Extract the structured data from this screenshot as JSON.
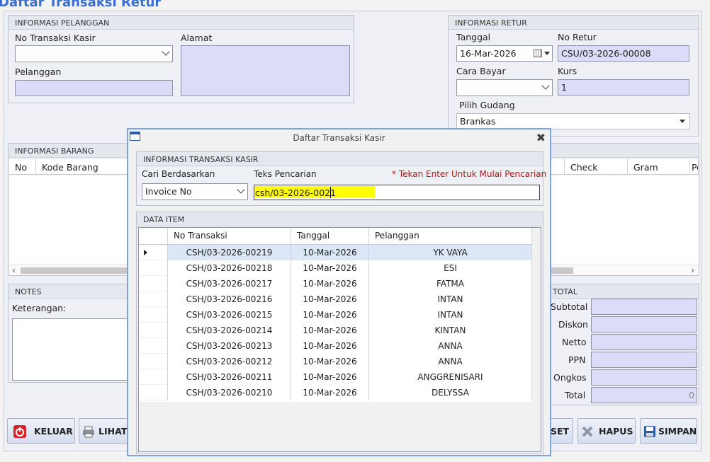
{
  "window_title_fragment": "Daftar Transaksi Retur",
  "customer": {
    "group_title": "INFORMASI PELANGGAN",
    "no_transaksi_label": "No Transaksi Kasir",
    "no_transaksi_value": "",
    "alamat_label": "Alamat",
    "alamat_value": "",
    "pelanggan_label": "Pelanggan",
    "pelanggan_value": ""
  },
  "retur": {
    "group_title": "INFORMASI RETUR",
    "tanggal_label": "Tanggal",
    "tanggal_value": "16-Mar-2026",
    "no_retur_label": "No Retur",
    "no_retur_value": "CSU/03-2026-00008",
    "cara_bayar_label": "Cara Bayar",
    "cara_bayar_value": "",
    "kurs_label": "Kurs",
    "kurs_value": "1",
    "gudang_label": "Pilih Gudang",
    "gudang_value": "Brankas"
  },
  "barang": {
    "group_title": "INFORMASI BARANG",
    "columns": [
      "No",
      "Kode Barang",
      "Check",
      "Gram",
      "Pe"
    ]
  },
  "notes": {
    "group_title": "NOTES",
    "keterangan_label": "Keterangan:",
    "keterangan_value": ""
  },
  "total": {
    "group_title": "TOTAL",
    "subtotal_label": "Subtotal",
    "diskon_label": "Diskon",
    "netto_label": "Netto",
    "ppn_label": "PPN",
    "ongkos_label": "Ongkos",
    "total_label": "Total",
    "total_value": "0"
  },
  "buttons": {
    "keluar": "KELUAR",
    "lihat": "LIHAT",
    "reset": "SET",
    "hapus": "HAPUS",
    "simpan": "SIMPAN"
  },
  "dialog": {
    "title": "Daftar Transaksi Kasir",
    "info_group_title": "INFORMASI TRANSAKSI KASIR",
    "cari_label": "Cari Berdasarkan",
    "cari_value": "Invoice No",
    "teks_label": "Teks Pencarian",
    "teks_value": "csh/03-2026-0021",
    "hint": "* Tekan Enter Untuk Mulai Pencarian",
    "data_group_title": "DATA ITEM",
    "columns": [
      "No Transaksi",
      "Tanggal",
      "Pelanggan"
    ],
    "rows": [
      {
        "no": "CSH/03-2026-00219",
        "tanggal": "10-Mar-2026",
        "pelanggan": "YK VAYA"
      },
      {
        "no": "CSH/03-2026-00218",
        "tanggal": "10-Mar-2026",
        "pelanggan": "ESI"
      },
      {
        "no": "CSH/03-2026-00217",
        "tanggal": "10-Mar-2026",
        "pelanggan": "FATMA"
      },
      {
        "no": "CSH/03-2026-00216",
        "tanggal": "10-Mar-2026",
        "pelanggan": "INTAN"
      },
      {
        "no": "CSH/03-2026-00215",
        "tanggal": "10-Mar-2026",
        "pelanggan": "INTAN"
      },
      {
        "no": "CSH/03-2026-00214",
        "tanggal": "10-Mar-2026",
        "pelanggan": "KINTAN"
      },
      {
        "no": "CSH/03-2026-00213",
        "tanggal": "10-Mar-2026",
        "pelanggan": "ANNA"
      },
      {
        "no": "CSH/03-2026-00212",
        "tanggal": "10-Mar-2026",
        "pelanggan": "ANNA"
      },
      {
        "no": "CSH/03-2026-00211",
        "tanggal": "10-Mar-2026",
        "pelanggan": "ANGGRENISARI"
      },
      {
        "no": "CSH/03-2026-00210",
        "tanggal": "10-Mar-2026",
        "pelanggan": "DELYSSA"
      }
    ],
    "selected_row": 0,
    "close_glyph": "✖"
  },
  "colors": {
    "readonly_field": "#dcdcf8",
    "highlight": "#ffff00",
    "accent_border": "#7fa2da",
    "hint_red": "#b01818"
  }
}
